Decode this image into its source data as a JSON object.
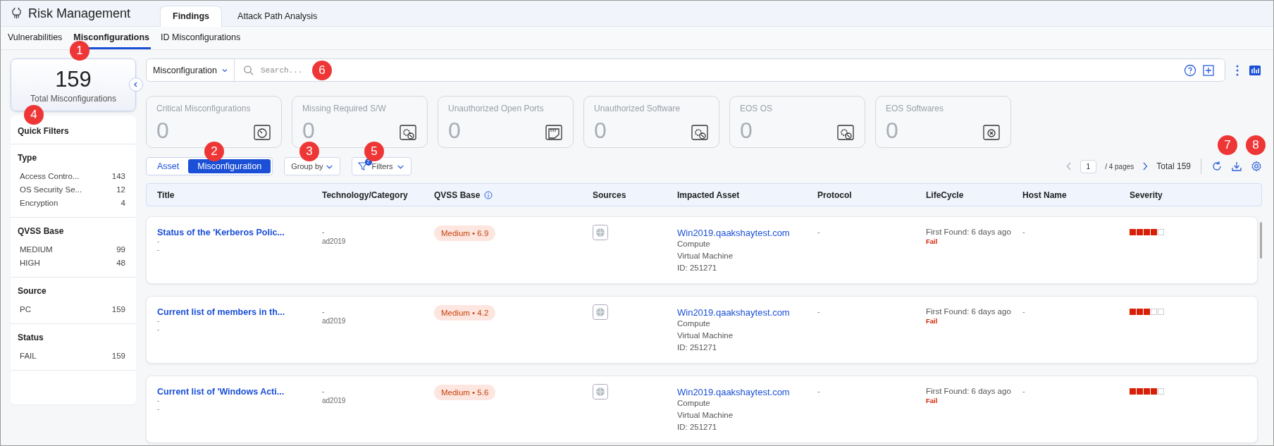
{
  "app": {
    "title": "Risk Management"
  },
  "main_tabs": [
    {
      "label": "Findings",
      "selected": true
    },
    {
      "label": "Attack Path Analysis",
      "selected": false
    }
  ],
  "sub_tabs": [
    {
      "label": "Vulnerabilities",
      "selected": false
    },
    {
      "label": "Misconfigurations",
      "selected": true
    },
    {
      "label": "ID Misconfigurations",
      "selected": false
    }
  ],
  "total": {
    "value": "159",
    "label": "Total Misconfigurations"
  },
  "quick_filters": {
    "title": "Quick Filters",
    "groups": [
      {
        "title": "Type",
        "items": [
          {
            "label": "Access Contro...",
            "count": "143"
          },
          {
            "label": "OS Security Se...",
            "count": "12"
          },
          {
            "label": "Encryption",
            "count": "4"
          }
        ]
      },
      {
        "title": "QVSS Base",
        "items": [
          {
            "label": "MEDIUM",
            "count": "99"
          },
          {
            "label": "HIGH",
            "count": "48"
          }
        ]
      },
      {
        "title": "Source",
        "items": [
          {
            "label": "PC",
            "count": "159"
          }
        ]
      },
      {
        "title": "Status",
        "items": [
          {
            "label": "FAIL",
            "count": "159"
          }
        ]
      }
    ]
  },
  "search": {
    "scope": "Misconfiguration",
    "placeholder": "Search..."
  },
  "summary_cards": [
    {
      "label": "Critical Misconfigurations",
      "value": "0"
    },
    {
      "label": "Missing Required S/W",
      "value": "0"
    },
    {
      "label": "Unauthorized Open Ports",
      "value": "0"
    },
    {
      "label": "Unauthorized Software",
      "value": "0"
    },
    {
      "label": "EOS OS",
      "value": "0"
    },
    {
      "label": "EOS Softwares",
      "value": "0"
    }
  ],
  "view_toggle": [
    {
      "label": "Asset",
      "selected": false
    },
    {
      "label": "Misconfiguration",
      "selected": true
    }
  ],
  "group_by": "Group by",
  "filters": {
    "label": "Filters",
    "badge": "2"
  },
  "pagination": {
    "page": "1",
    "pages": "/ 4 pages",
    "total": "Total 159"
  },
  "table": {
    "columns": [
      "Title",
      "Technology/Category",
      "QVSS Base",
      "Sources",
      "Impacted Asset",
      "Protocol",
      "LifeCycle",
      "Host Name",
      "Severity"
    ],
    "rows": [
      {
        "title": "Status of the 'Kerberos Polic...",
        "title_lines": [
          "-",
          "-"
        ],
        "tech": [
          "-",
          "ad2019"
        ],
        "qvss": "Medium • 6.9",
        "asset": "Win2019.qaakshaytest.com",
        "asset_lines": [
          "Compute",
          "Virtual Machine",
          "ID: 251271"
        ],
        "protocol": "-",
        "lifecycle": "First Found: 6 days ago",
        "status": "Fail",
        "host": "-",
        "stars": 4
      },
      {
        "title": "Current list of members in th...",
        "title_lines": [
          "-",
          "-"
        ],
        "tech": [
          "-",
          "ad2019"
        ],
        "qvss": "Medium • 4.2",
        "asset": "Win2019.qaakshaytest.com",
        "asset_lines": [
          "Compute",
          "Virtual Machine",
          "ID: 251271"
        ],
        "protocol": "-",
        "lifecycle": "First Found: 6 days ago",
        "status": "Fail",
        "host": "-",
        "stars": 3
      },
      {
        "title": "Current list of 'Windows Acti...",
        "title_lines": [
          "-",
          "-"
        ],
        "tech": [
          "-",
          "ad2019"
        ],
        "qvss": "Medium • 5.6",
        "asset": "Win2019.qaakshaytest.com",
        "asset_lines": [
          "Compute",
          "Virtual Machine",
          "ID: 251271"
        ],
        "protocol": "-",
        "lifecycle": "First Found: 6 days ago",
        "status": "Fail",
        "host": "-",
        "stars": 4
      }
    ]
  },
  "callouts": [
    "1",
    "2",
    "3",
    "4",
    "5",
    "6",
    "7",
    "8"
  ]
}
